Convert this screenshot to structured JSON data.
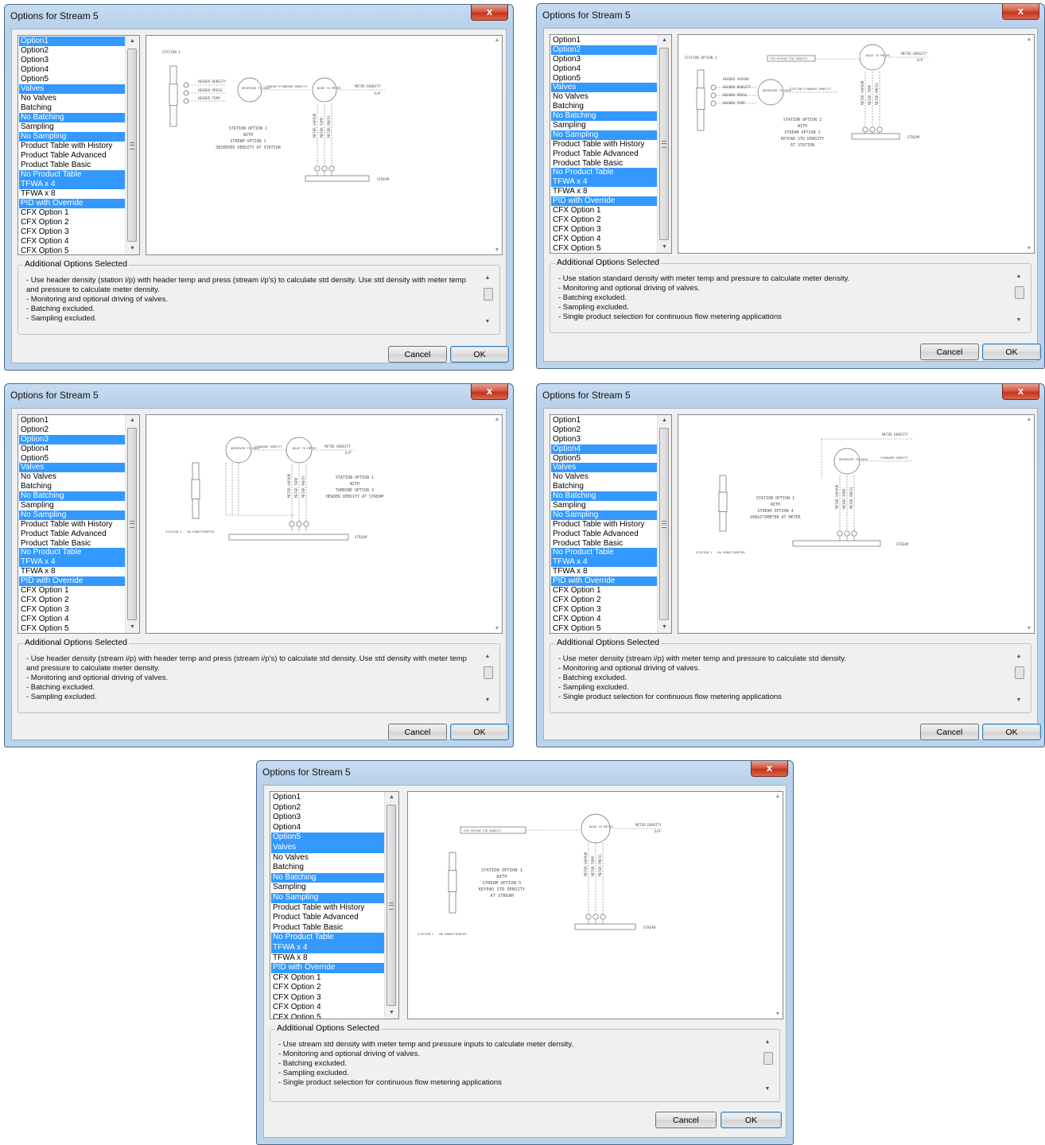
{
  "window_title": "Options for Stream 5",
  "close_glyph": "x",
  "options_list": [
    "Option1",
    "Option2",
    "Option3",
    "Option4",
    "Option5",
    "Valves",
    "No Valves",
    "Batching",
    "No Batching",
    "Sampling",
    "No Sampling",
    "Product Table with History",
    "Product Table Advanced",
    "Product Table Basic",
    "No Product Table",
    "TFWA x 4",
    "TFWA x 8",
    "PID with Override",
    "CFX Option 1",
    "CFX Option 2",
    "CFX Option 3",
    "CFX Option 4",
    "CFX Option 5"
  ],
  "group_label": "Additional Options Selected",
  "cancel_label": "Cancel",
  "ok_label": "OK",
  "accent_color": "#3399ff",
  "close_button_color": "#c7432a",
  "dialogs": [
    {
      "selected_option": "Option1",
      "description": [
        "- Use header density (station i/p) with header temp and press (stream i/p's) to calculate std density. Use std density with meter temp and pressure to calculate meter density.",
        "- Monitoring and optional driving of valves.",
        "- Batching excluded.",
        "- Sampling excluded."
      ],
      "diagram": {
        "station_label": "STATION 1",
        "labels": [
          "HEADER DENSITY",
          "HEADER PRESS",
          "HEADER TEMP",
          "OBSERVED TO BASE",
          "STREAM STANDARD DENSITY",
          "BASE TO METER",
          "METER DENSITY",
          "O/P",
          "METER VAPOUR",
          "METER TEMP",
          "METER PRESS",
          "STREAM"
        ],
        "caption": [
          "STATION OPTION 2",
          "WITH",
          "STREAM OPTION 1",
          "OBSERVED DENSITY AT STATION"
        ]
      }
    },
    {
      "selected_option": "Option2",
      "description": [
        "- Use station standard density with meter temp and pressure to calculate meter density.",
        "- Monitoring and optional driving of valves.",
        "- Batching excluded.",
        "- Sampling excluded.",
        "- Single product selection for continuous flow metering applications"
      ],
      "diagram": {
        "station_label": "STATION OPTION 3",
        "labels": [
          "STN KEYPAD STD DENSITY",
          "BASE TO METER",
          "METER DENSITY",
          "O/P",
          "HEADER VAPOUR",
          "HEADER DENSITY",
          "HEADER PRESS",
          "HEADER TEMP",
          "OBSERVED TO BASE",
          "STATION STANDARD DENSITY",
          "METER VAPOUR",
          "METER TEMP",
          "METER PRESS",
          "STREAM"
        ],
        "caption": [
          "STATION OPTION 3",
          "WITH",
          "STREAM OPTION 2",
          "KEYPAD STD DENSITY",
          "AT STATION"
        ]
      }
    },
    {
      "selected_option": "Option3",
      "description": [
        "- Use header density (stream i/p) with header temp and press (stream i/p's) to calculate std density. Use std density with meter temp and pressure to calculate meter density.",
        "- Monitoring and optional driving of valves.",
        "- Batching excluded.",
        "- Sampling excluded."
      ],
      "diagram": {
        "station_label": "STATION 1 - NO DENSITOMETER",
        "labels": [
          "OBSERVED TO BASE",
          "STANDARD DENSITY",
          "BASE TO METER",
          "METER DENSITY",
          "O/P",
          "METER VAPOUR",
          "METER TEMP",
          "METER PRESS",
          "STREAM"
        ],
        "caption": [
          "STATION OPTION 1",
          "WITH",
          "TURBINE OPTION 3",
          "HEADER DENSITY AT STREAM"
        ]
      }
    },
    {
      "selected_option": "Option4",
      "description": [
        "- Use meter density (stream i/p) with meter temp and pressure to calculate std density.",
        "- Monitoring and optional driving of valves.",
        "- Batching excluded.",
        "- Sampling excluded.",
        "- Single product selection for continuous flow metering applications"
      ],
      "diagram": {
        "station_label": "STATION 1 - NO DENSITOMETER",
        "labels": [
          "METER DENSITY",
          "OBSERVED TO BASE",
          "STANDARD DENSITY",
          "METER VAPOUR",
          "METER TEMP",
          "METER PRESS",
          "STREAM"
        ],
        "caption": [
          "STATION OPTION 1",
          "WITH",
          "STREAM OPTION 4",
          "DENSITOMETER AT METER"
        ]
      }
    },
    {
      "selected_option": "Option5",
      "description": [
        "- Use stream std density with meter temp and pressure inputs to calculate meter density.",
        "- Monitoring and optional driving of valves.",
        "- Batching excluded.",
        "- Sampling excluded.",
        "- Single product selection for continuous flow metering applications"
      ],
      "diagram": {
        "station_label": "STATION 1 - NO DENSITOMETER",
        "labels": [
          "STR KEYPAD STD DENSITY",
          "BASE TO METER",
          "METER DENSITY",
          "O/P",
          "METER VAPOUR",
          "METER TEMP",
          "METER PRESS",
          "STREAM"
        ],
        "caption": [
          "STATION OPTION 1",
          "WITH",
          "STREAM OPTION 5",
          "KEYPAD STD DENSITY",
          "AT STREAM"
        ]
      }
    }
  ]
}
